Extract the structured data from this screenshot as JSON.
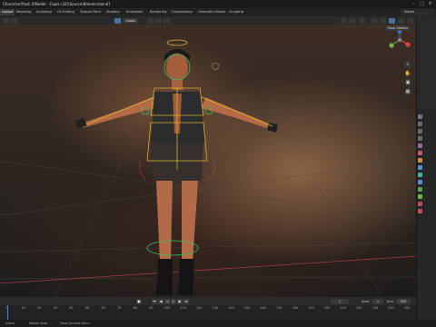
{
  "window": {
    "title": "Character\\Pack 2\\Model - Copie (34)\\Source\\Blender.blend]"
  },
  "workspaces": {
    "tabs": [
      "Layout",
      "Modeling",
      "Sculpting",
      "UV Editing",
      "Texture Paint",
      "Shading",
      "Animation",
      "Rendering",
      "Compositing",
      "Geometry Nodes",
      "Scripting"
    ],
    "active": "Layout",
    "scene_label": "Scene"
  },
  "viewport_header": {
    "mode_label": "Global",
    "pose_options_label": "Pose Options"
  },
  "timeline": {
    "current_frame": "1",
    "start_label": "Start",
    "start_value": "1",
    "end_label": "End",
    "end_value": "250",
    "ticks": [
      "0",
      "10",
      "20",
      "30",
      "40",
      "50",
      "60",
      "70",
      "80",
      "90",
      "100",
      "110",
      "120",
      "130",
      "140",
      "150",
      "160",
      "170",
      "180",
      "190",
      "200",
      "210",
      "220",
      "230",
      "240",
      "250"
    ]
  },
  "statusbar": {
    "left_label": "Select",
    "middle_label": "Rotate View",
    "right_label": "Pose Context Menu"
  },
  "icons": {
    "gizmo_x": "#e0434e",
    "gizmo_y": "#6fb33e",
    "gizmo_z": "#3f7fd8",
    "bone_color": "#d7b233",
    "ik_color": "#3fbf63"
  }
}
